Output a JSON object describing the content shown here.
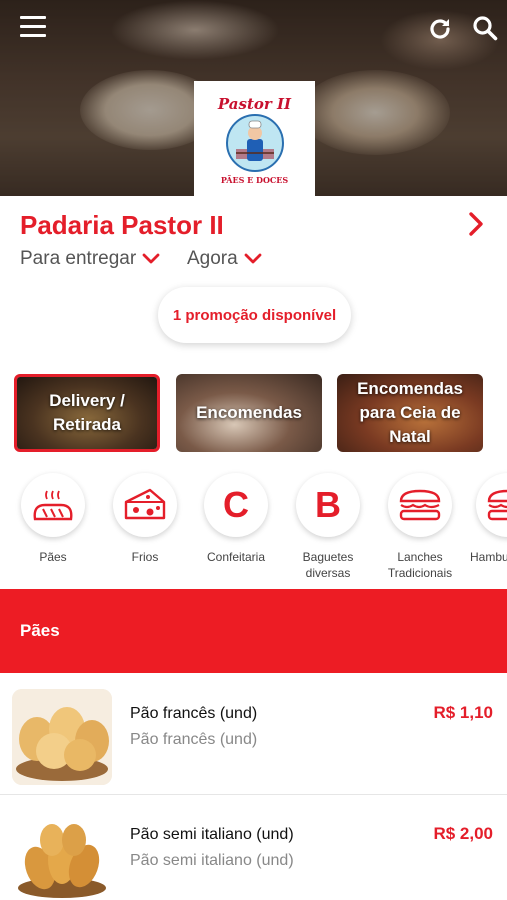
{
  "header": {
    "menu_icon": "hamburger-menu-icon",
    "refresh_icon": "refresh-icon",
    "search_icon": "search-icon",
    "logo": {
      "title": "Pastor II",
      "subtitle": "PÃES E DOCES"
    }
  },
  "store": {
    "name": "Padaria Pastor II",
    "delivery_option": "Para entregar",
    "time_option": "Agora",
    "promo_label": "1 promoção disponível"
  },
  "banners": [
    {
      "label": "Delivery / Retirada",
      "active": true
    },
    {
      "label": "Encomendas",
      "active": false
    },
    {
      "label": "Encomendas para Ceia de Natal",
      "active": false
    }
  ],
  "categories": [
    {
      "label": "Pães",
      "icon": "bread-icon"
    },
    {
      "label": "Frios",
      "icon": "cheese-icon"
    },
    {
      "label": "Confeitaria",
      "icon": "letter-c-icon",
      "letter": "C"
    },
    {
      "label": "Baguetes diversas",
      "icon": "letter-b-icon",
      "letter": "B"
    },
    {
      "label": "Lanches Tradicionais",
      "icon": "sandwich-icon"
    },
    {
      "label": "Hambu",
      "icon": "burger-icon"
    }
  ],
  "section": {
    "title": "Pães"
  },
  "products": [
    {
      "name": "Pão francês (und)",
      "description": "Pão francês (und)",
      "price": "R$ 1,10"
    },
    {
      "name": "Pão semi italiano (und)",
      "description": "Pão semi italiano (und)",
      "price": "R$ 2,00"
    }
  ],
  "colors": {
    "brand_red": "#e41e2a",
    "section_red": "#ed1c24"
  }
}
